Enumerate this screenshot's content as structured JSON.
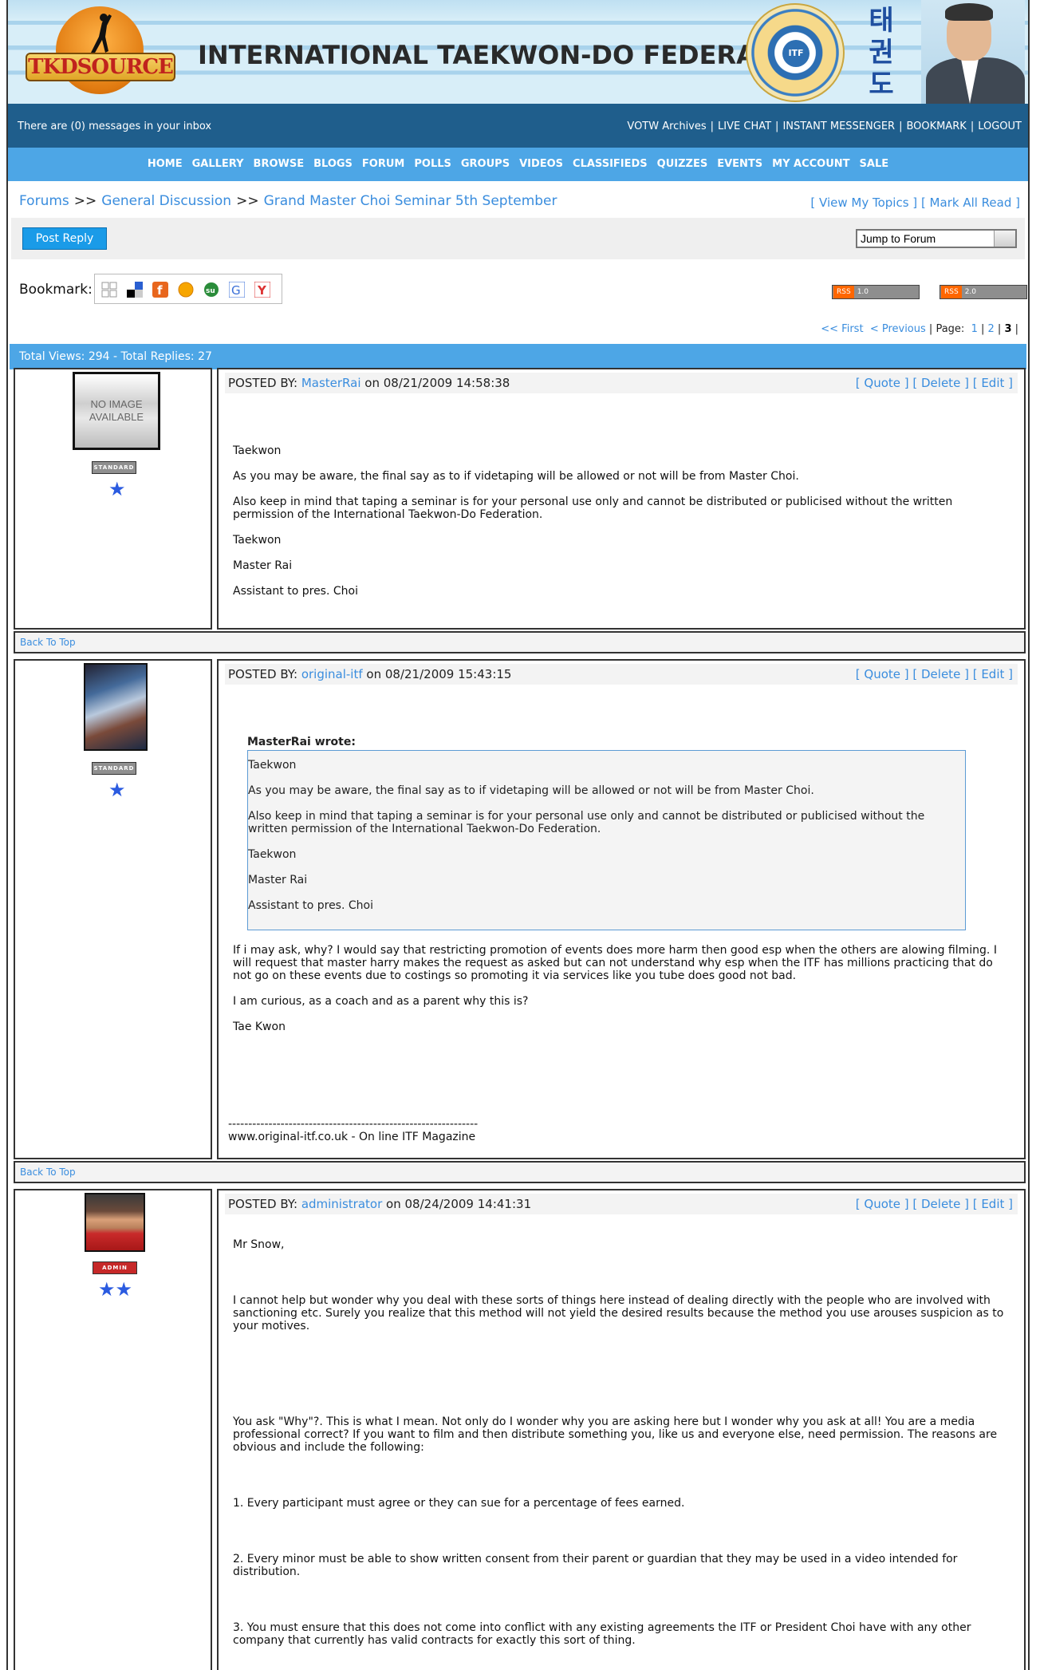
{
  "header": {
    "logo_text": "TKDSOURCE",
    "site_title": "INTERNATIONAL TAEKWON-DO FEDERATION",
    "seal_text": "ITF",
    "hangul": [
      "태",
      "권",
      "도"
    ]
  },
  "topbar": {
    "inbox_text": "There are (0) messages in your inbox",
    "links": [
      "VOTW Archives",
      "LIVE CHAT",
      "INSTANT MESSENGER",
      "BOOKMARK",
      "LOGOUT"
    ]
  },
  "nav": {
    "items": [
      "HOME",
      "GALLERY",
      "BROWSE",
      "BLOGS",
      "FORUM",
      "POLLS",
      "GROUPS",
      "VIDEOS",
      "CLASSIFIEDS",
      "QUIZZES",
      "EVENTS",
      "MY ACCOUNT",
      "SALE"
    ]
  },
  "breadcrumb": {
    "items": [
      "Forums",
      "General Discussion",
      "Grand Master Choi Seminar 5th September"
    ],
    "separator": ">>",
    "right_links": [
      "[ View My Topics ]",
      "[ Mark All Read ]"
    ]
  },
  "actions": {
    "post_reply": "Post Reply",
    "jump_to_forum": "Jump to Forum"
  },
  "bookmark": {
    "label": "Bookmark:",
    "icons": [
      "digg-icon",
      "delicious-icon",
      "facebook-icon",
      "reddit-icon",
      "stumbleupon-icon",
      "google-icon",
      "yahoo-icon"
    ],
    "rss": [
      {
        "tag": "RSS",
        "version": "1.0"
      },
      {
        "tag": "RSS",
        "version": "2.0"
      }
    ]
  },
  "pager": {
    "first": "<< First",
    "previous": "< Previous",
    "page_label": "Page:",
    "pages": [
      "1",
      "2",
      "3"
    ],
    "current": "3"
  },
  "stats": "Total Views: 294 - Total Replies: 27",
  "post_labels": {
    "posted_by": "POSTED BY:",
    "on": "on",
    "quote": "[ Quote ]",
    "delete": "[ Delete ]",
    "edit": "[ Edit ]",
    "back_to_top": "Back To Top"
  },
  "posts": [
    {
      "author": "MasterRai",
      "date": "08/21/2009 14:58:38",
      "rank": "STANDARD",
      "avatar_text": "NO IMAGE AVAILABLE",
      "body": [
        "Taekwon",
        "As you may be aware, the final say as to if videtaping will be allowed or not will be from Master Choi.",
        "Also keep in mind that taping a seminar is for your personal use only and cannot be distributed or publicised without the written permission of the International Taekwon-Do Federation.",
        "Taekwon",
        "Master Rai",
        "Assistant to pres. Choi"
      ]
    },
    {
      "author": "original-itf",
      "date": "08/21/2009 15:43:15",
      "rank": "STANDARD",
      "quote_author": "MasterRai wrote:",
      "quote": [
        "Taekwon",
        "As you may be aware, the final say as to if videtaping will be allowed or not will be from Master Choi.",
        "Also keep in mind that taping a seminar is for your personal use only and cannot be distributed or publicised without the written permission of the International Taekwon-Do Federation.",
        "Taekwon",
        "Master Rai",
        "Assistant to pres. Choi"
      ],
      "body": [
        "If i may ask, why? I would say that restricting promotion of events does more harm then good esp when the others are alowing filming. I  will request that master harry makes the request as asked but can not understand why esp when the ITF has millions practicing that do not go on these events due to costings so promoting it via services like you tube does good not bad.",
        "I  am curious, as a coach and as a parent why this is?",
        "Tae Kwon"
      ],
      "signature_line": "--------------------------------------------------------------",
      "signature": "www.original-itf.co.uk - On line ITF Magazine"
    },
    {
      "author": "administrator",
      "date": "08/24/2009 14:41:31",
      "rank": "ADMIN",
      "body": [
        "Mr Snow,",
        "I cannot help but wonder why you deal with these sorts of things here instead of dealing directly with the people who are involved with sanctioning etc. Surely you realize that this method will not yield the desired results because the method you use arouses suspicion as to your motives.",
        "You ask \"Why\"?. This is what I mean. Not only do I wonder why you are asking here but I wonder why you ask at all! You are a media professional correct? If you want to film and then distribute something you, like us and everyone else, need permission. The reasons are obvious and include the following:",
        "1. Every participant must agree or they can sue for a percentage of fees earned.",
        "2. Every minor must be able to show written consent from their parent or guardian that they may be used in a video intended for distribution.",
        "3. You must ensure that this does not come into conflict with any existing agreements the ITF or President Choi have with any other company that currently has valid contracts for exactly this sort of thing."
      ]
    }
  ],
  "colors": {
    "topbar": "#1f5e8c",
    "nav": "#4da6e6",
    "link": "#3a8dde",
    "button": "#1a9be8"
  }
}
